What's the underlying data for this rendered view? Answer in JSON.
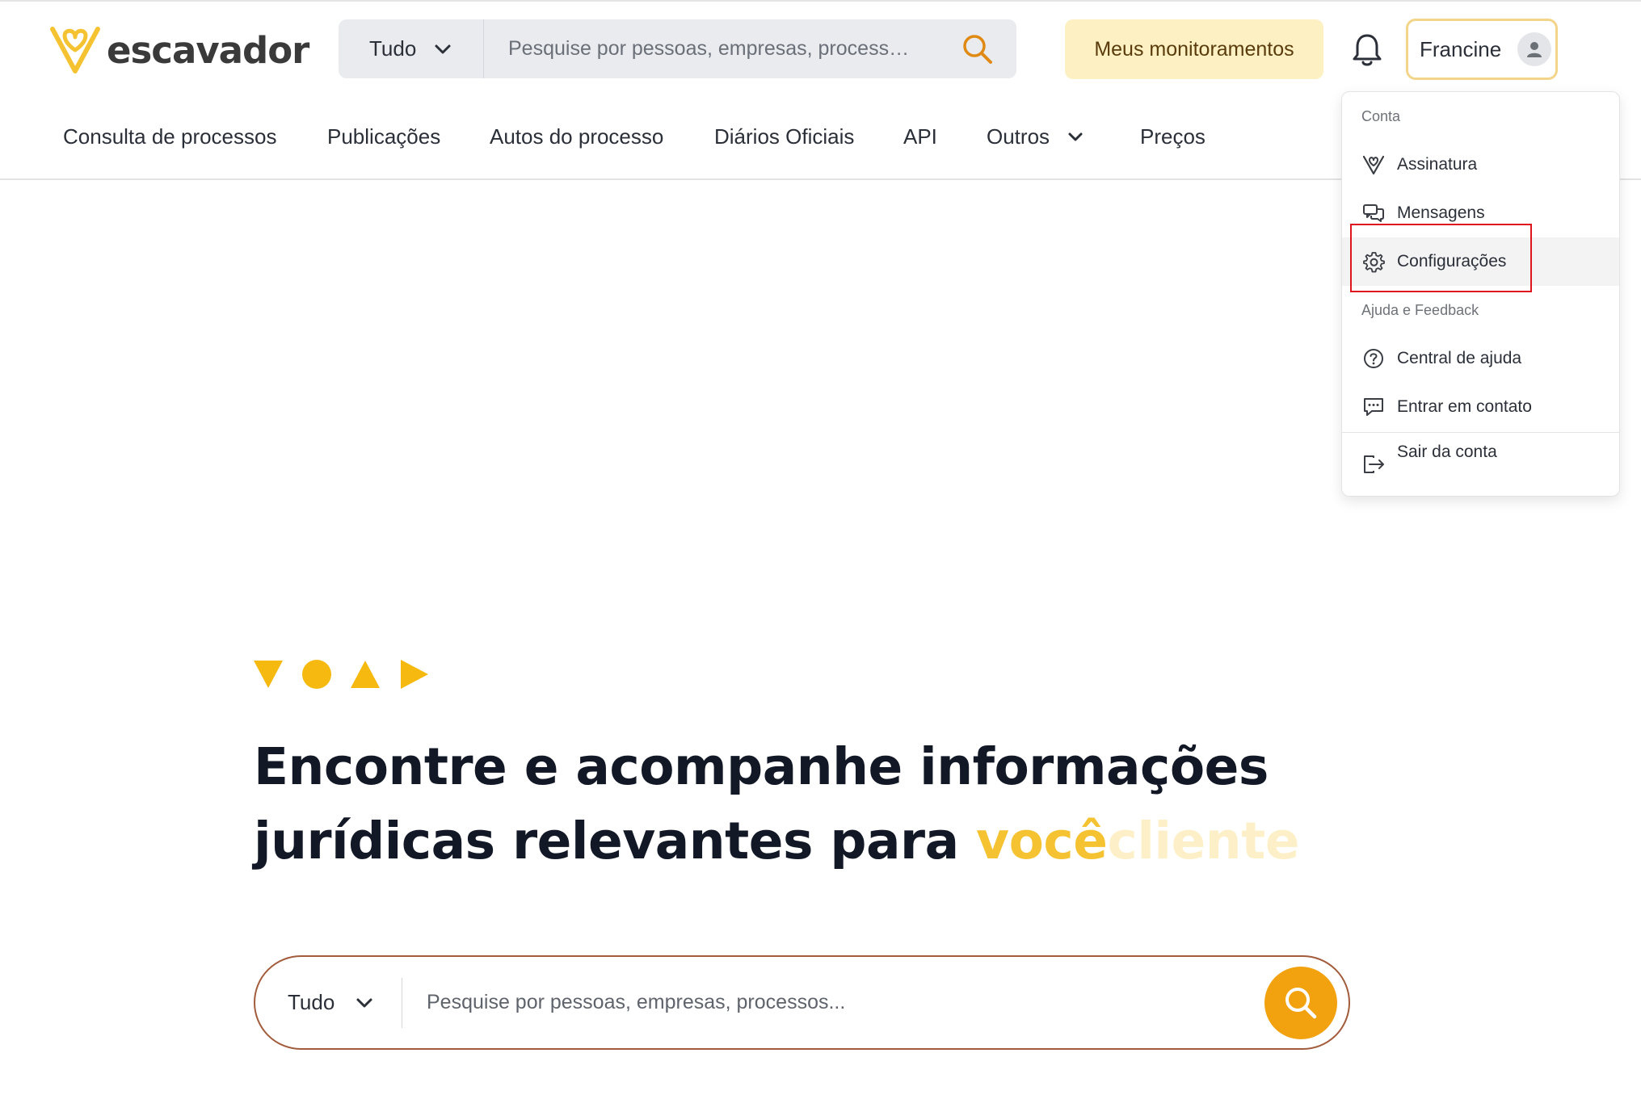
{
  "brand": {
    "name": "escavador",
    "logo_color": "#f5c332",
    "text_color": "#3a3a3a"
  },
  "header": {
    "search": {
      "scope": "Tudo",
      "placeholder": "Pesquise por pessoas, empresas, process…",
      "search_icon": "search-icon",
      "icon_color": "#e08a14"
    },
    "monitor_button": "Meus monitoramentos",
    "notifications_icon": "bell-icon",
    "user": {
      "name": "Francine",
      "avatar_icon": "user-avatar-icon"
    }
  },
  "nav": {
    "items": [
      {
        "label": "Consulta de processos"
      },
      {
        "label": "Publicações"
      },
      {
        "label": "Autos do processo"
      },
      {
        "label": "Diários Oficiais"
      },
      {
        "label": "API"
      },
      {
        "label": "Outros",
        "has_dropdown": true
      },
      {
        "label": "Preços"
      }
    ]
  },
  "user_menu": {
    "sections": [
      {
        "title": "Conta",
        "items": [
          {
            "label": "Assinatura",
            "icon": "badge-v-icon"
          },
          {
            "label": "Mensagens",
            "icon": "chat-bubbles-icon"
          },
          {
            "label": "Configurações",
            "icon": "gear-icon",
            "hovered": true,
            "highlighted": true
          }
        ]
      },
      {
        "title": "Ajuda e Feedback",
        "items": [
          {
            "label": "Central de ajuda",
            "icon": "help-circle-icon"
          },
          {
            "label": "Entrar em contato",
            "icon": "message-dots-icon"
          }
        ]
      },
      {
        "title": "",
        "items": [
          {
            "label": "Sair da conta",
            "icon": "logout-icon"
          }
        ]
      }
    ],
    "highlight_color": "#e0141e"
  },
  "hero": {
    "decor_shapes": [
      "triangle-down-icon",
      "circle-icon",
      "triangle-up-icon",
      "triangle-right-icon"
    ],
    "title_line1": "Encontre e acompanhe informações",
    "title_line2": "jurídicas relevantes para",
    "title_accent": "você",
    "title_accent_fading": "cliente",
    "accent_color": "#f5c332",
    "search": {
      "scope": "Tudo",
      "placeholder": "Pesquise por pessoas, empresas, processos...",
      "button_color": "#f2a20f",
      "border_color": "#a25c3c"
    }
  }
}
